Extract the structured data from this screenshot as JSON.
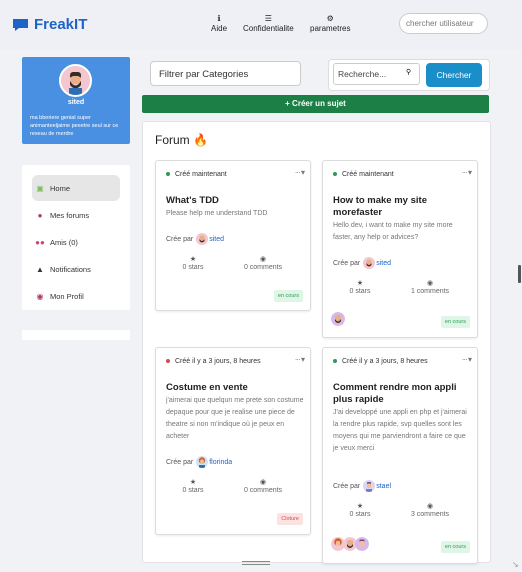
{
  "app": {
    "name": "FreakIT"
  },
  "nav": [
    {
      "label": "Aide",
      "icon": "info-icon"
    },
    {
      "label": "Confidentialite",
      "icon": "list-icon"
    },
    {
      "label": "parametres",
      "icon": "gear-icon"
    }
  ],
  "user_search": {
    "placeholder": "chercher utilisateur"
  },
  "profile": {
    "name": "sited",
    "bio": "ma bberiere genial super animanteeljaime peeetre seul sur ce reseau de merdre"
  },
  "menu": [
    {
      "label": "Home",
      "icon": "home-icon",
      "active": true
    },
    {
      "label": "Mes forums",
      "icon": "chat-icon"
    },
    {
      "label": "Amis (0)",
      "icon": "friends-icon"
    },
    {
      "label": "Notifications",
      "icon": "bell-icon"
    },
    {
      "label": "Mon Profil",
      "icon": "user-icon"
    }
  ],
  "filter": {
    "placeholder": "Filtrer par Categories"
  },
  "search": {
    "placeholder": "Recherche...",
    "button": "Chercher"
  },
  "create_button": "+ Créer un sujet",
  "forum": {
    "title": "Forum 🔥",
    "posts": [
      {
        "status_text": "Créé maintenant",
        "status_color": "#2b9c55",
        "title": "What's TDD",
        "desc": "Please help me understand TDD",
        "by_label": "Crée par",
        "author": "sited",
        "stars": "0 stars",
        "comments": "0 comments",
        "badge": "en cours"
      },
      {
        "status_text": "Créé maintenant",
        "status_color": "#2b9c55",
        "title": "How to make my site morefaster",
        "desc": "Hello dev, i want to make my site more faster, any help or advices?",
        "by_label": "Crée par",
        "author": "sited",
        "stars": "0 stars",
        "comments": "1 comments",
        "badge": "en cours"
      },
      {
        "status_text": "Créé il y a 3 jours, 8 heures",
        "status_color": "#d44b4b",
        "title": "Costume en vente",
        "desc": "j'aimerai que quelqun me prete son costume depaque pour que je realise une piece de theatre si non m'indique où je peux en acheter",
        "by_label": "Crée par",
        "author": "florinda",
        "stars": "0 stars",
        "comments": "0 comments",
        "badge": "Cloture"
      },
      {
        "status_text": "Créé il y a 3 jours, 8 heures",
        "status_color": "#2b9c55",
        "title": "Comment rendre mon appli plus rapide",
        "desc": "J'ai developpé une appli en php et j'aimerai la rendre plus rapide, svp quelles sont les moyens qui me parviendront a faire ce que je veux merci",
        "by_label": "Crée par",
        "author": "stael",
        "stars": "0 stars",
        "comments": "3 comments",
        "badge": "en cours"
      }
    ]
  }
}
